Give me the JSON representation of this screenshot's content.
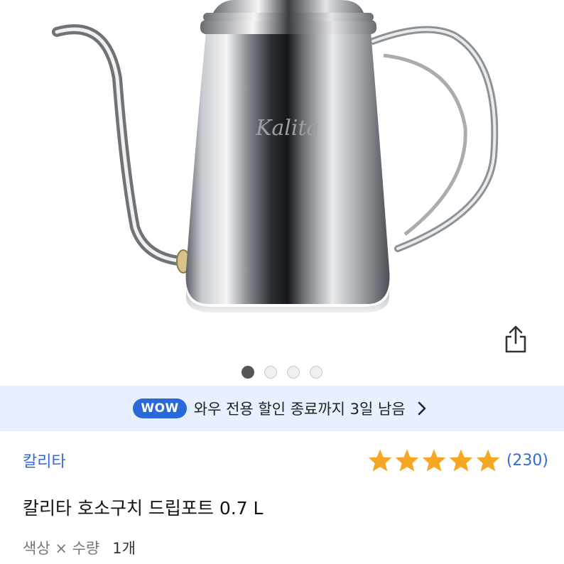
{
  "product": {
    "image_alt": "Kalita",
    "logo_text": "Kalita",
    "gallery": {
      "total": 4,
      "active_index": 0
    },
    "share_icon": "share-icon"
  },
  "wow_banner": {
    "badge": "WOW",
    "text": "와우 전용 할인 종료까지 3일 남음",
    "icon": "chevron-right-icon",
    "badge_color": "#2a6ad8",
    "background_color": "#e8efff"
  },
  "brand": {
    "name": "칼리타",
    "color": "#346ad6"
  },
  "rating": {
    "stars": 5,
    "max_stars": 5,
    "review_count": "(230)",
    "star_color": "#f5a623"
  },
  "title": "칼리타 호소구치 드립포트 0.7 L",
  "option": {
    "label": "색상 × 수량",
    "value": "1개"
  }
}
